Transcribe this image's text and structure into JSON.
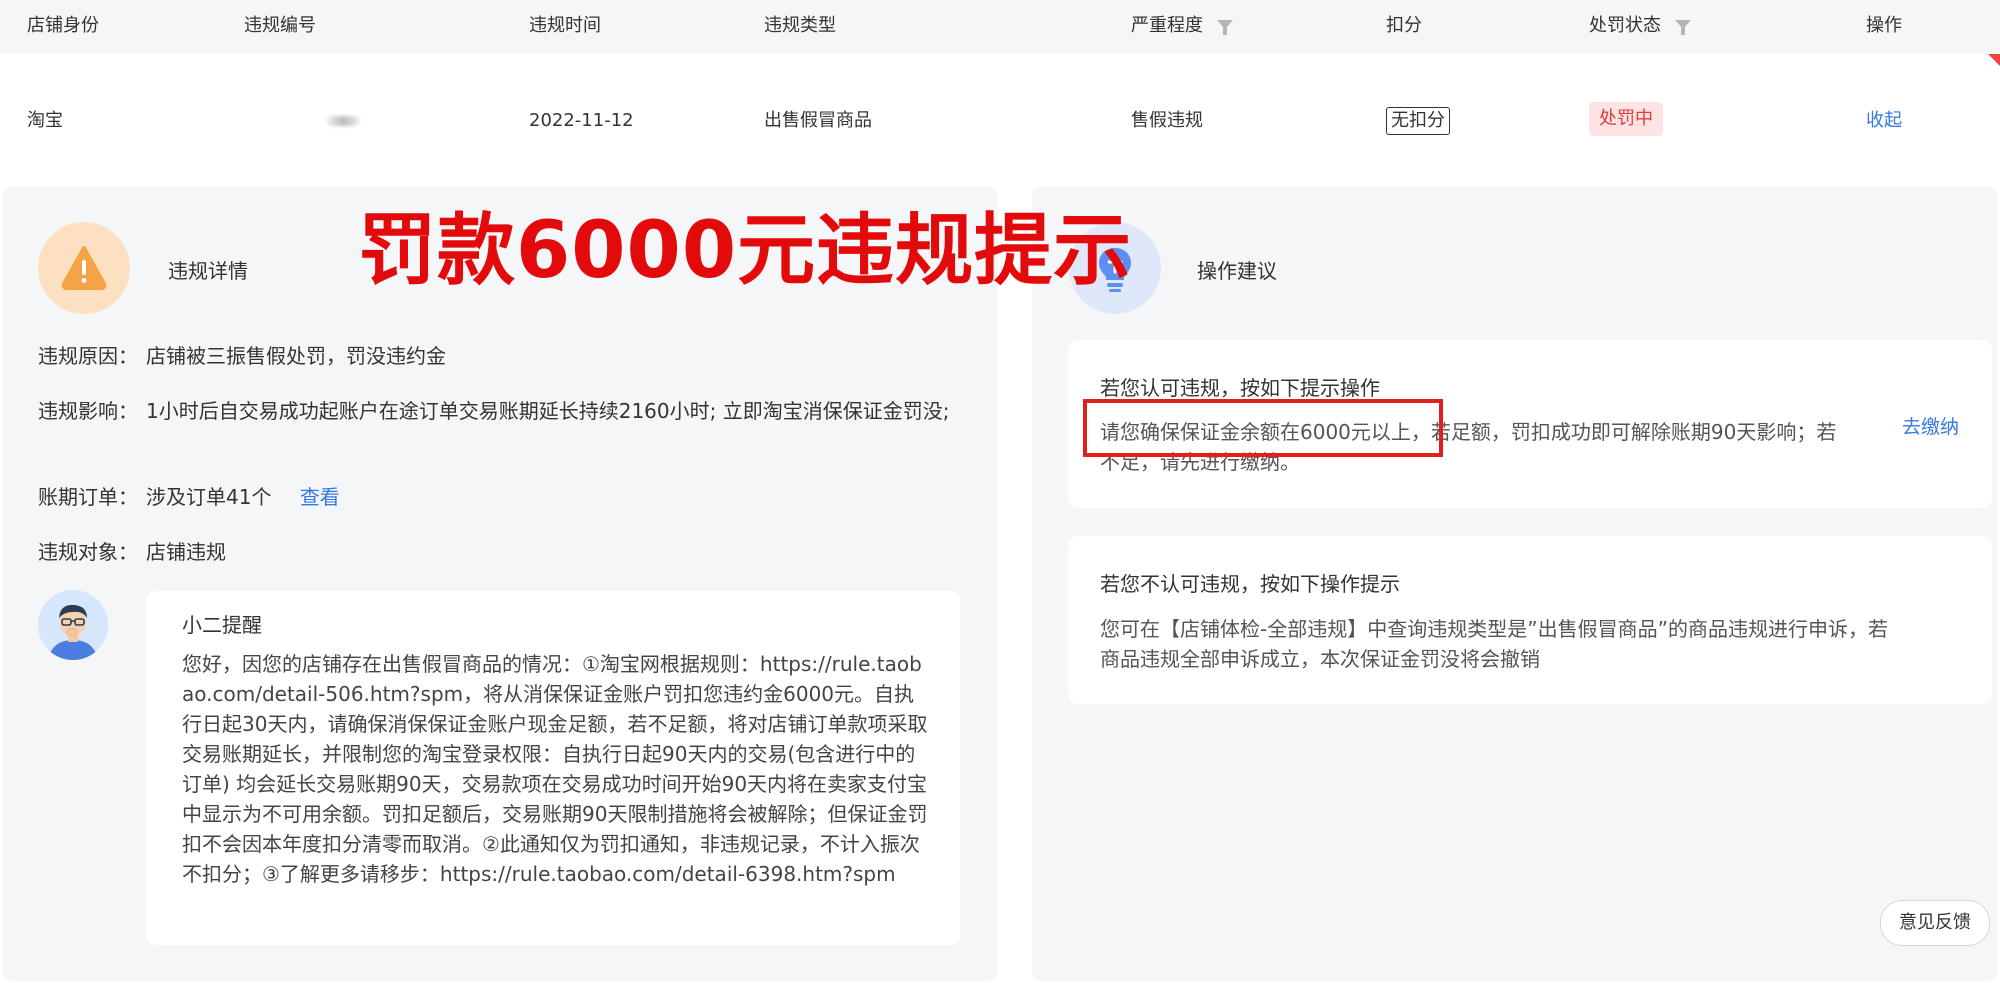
{
  "table": {
    "headers": {
      "shop_identity": "店铺身份",
      "violation_id": "违规编号",
      "violation_time": "违规时间",
      "violation_type": "违规类型",
      "severity": "严重程度",
      "deduction": "扣分",
      "penalty_status": "处罚状态",
      "actions": "操作"
    },
    "row": {
      "shop_identity": "淘宝",
      "violation_id_suffix": "5",
      "violation_time": "2022-11-12",
      "violation_type": "出售假冒商品",
      "severity": "售假违规",
      "deduction": "无扣分",
      "penalty_status": "处罚中",
      "collapse_link": "收起"
    }
  },
  "banner": "罚款6000元违规提示",
  "detail": {
    "title": "违规详情",
    "reason_label": "违规原因：",
    "reason_value": "店铺被三振售假处罚，罚没违约金",
    "impact_label": "违规影响：",
    "impact_value": "1小时后自交易成功起账户在途订单交易账期延长持续2160小时; 立即淘宝消保保证金罚没;",
    "orders_label": "账期订单：",
    "orders_value": "涉及订单41个",
    "orders_link": "查看",
    "target_label": "违规对象：",
    "target_value": "店铺违规"
  },
  "reminder": {
    "title": "小二提醒",
    "text": "您好，因您的店铺存在出售假冒商品的情况：①淘宝网根据规则：https://rule.taobao.com/detail-506.htm?spm，将从消保保证金账户罚扣您违约金6000元。自执行日起30天内，请确保消保保证金账户现金足额，若不足额，将对店铺订单款项采取交易账期延长，并限制您的淘宝登录权限：自执行日起90天内的交易(包含进行中的订单) 均会延长交易账期90天，交易款项在交易成功时间开始90天内将在卖家支付宝中显示为不可用余额。罚扣足额后，交易账期90天限制措施将会被解除；但保证金罚扣不会因本年度扣分清零而取消。②此通知仅为罚扣通知，非违规记录，不计入振次不扣分；③了解更多请移步：https://rule.taobao.com/detail-6398.htm?spm"
  },
  "suggestion": {
    "title": "操作建议",
    "accept_title": "若您认可违规，按如下提示操作",
    "accept_text": "请您确保保证金余额在6000元以上，若足额，罚扣成功即可解除账期90天影响；若不足，请先进行缴纳。",
    "pay_link": "去缴纳",
    "dispute_title": "若您不认可违规，按如下操作提示",
    "dispute_text": "您可在【店铺体检-全部违规】中查询违规类型是”出售假冒商品”的商品违规进行申诉，若商品违规全部申诉成立，本次保证金罚没将会撤销"
  },
  "feedback_button": "意见反馈",
  "icons": {
    "warning": "warning-triangle-icon",
    "bulb": "lightbulb-icon",
    "filter": "filter-icon",
    "avatar": "assistant-avatar"
  },
  "colors": {
    "accent_blue": "#3478e0",
    "danger_red": "#e4393c",
    "banner_red": "#e20a0a",
    "warning_orange": "#f5a347"
  }
}
